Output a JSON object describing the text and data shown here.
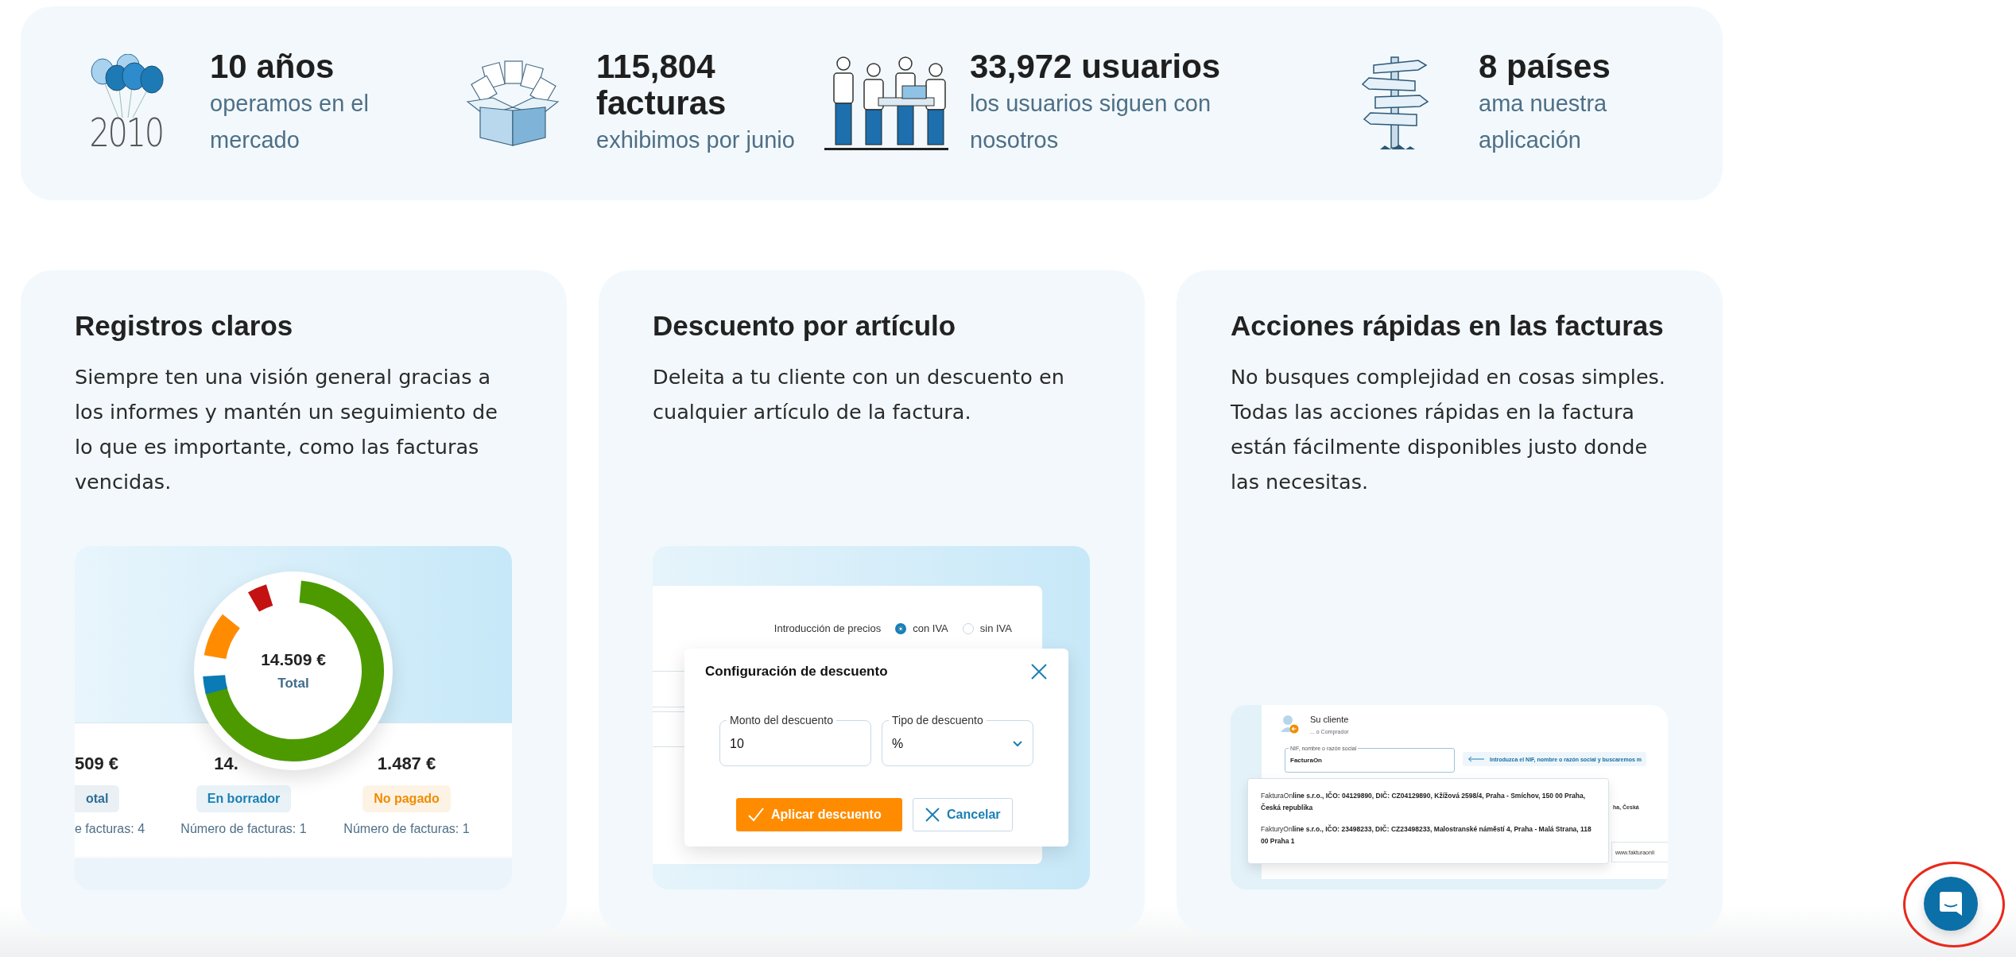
{
  "stats": [
    {
      "kind": "balloons",
      "illustration_text": "2010",
      "value": "10 años",
      "caption": "operamos en el mercado"
    },
    {
      "kind": "box",
      "value": "115,804 facturas",
      "caption": "exhibimos por junio"
    },
    {
      "kind": "team",
      "value": "33,972 usuarios",
      "caption": "los usuarios siguen con nosotros"
    },
    {
      "kind": "signpost",
      "value": "8 países",
      "caption": "ama nuestra aplicación"
    }
  ],
  "features": [
    {
      "kind": "report",
      "title": "Registros claros",
      "text": "Siempre ten una visión general gracias a los informes y mantén un seguimiento de lo que es importante, como las facturas vencidas.",
      "mockup": {
        "total_value": "14.509 €",
        "total_label": "Total",
        "columns": [
          {
            "amount": "509 €",
            "status": "otal",
            "count": "e facturas: 4",
            "color": "#2d6d96"
          },
          {
            "amount": "14.",
            "status": "En borrador",
            "count": "Número de facturas: 1",
            "color": "#1a7fb5"
          },
          {
            "amount": "1.487 €",
            "status": "No pagado",
            "count": "Número de facturas: 1",
            "color": "#f08c00"
          }
        ]
      }
    },
    {
      "kind": "discount",
      "title": "Descuento por artículo",
      "text": "Deleita a tu cliente con un descuento en cualquier artículo de la factura.",
      "mockup": {
        "price_label": "Introducción de precios",
        "price_options": [
          {
            "label": "con IVA",
            "selected": true
          },
          {
            "label": "sin IVA",
            "selected": false
          }
        ],
        "dialog_title": "Configuración de descuento",
        "fields": [
          {
            "kind": "text",
            "label": "Monto del descuento",
            "value": "10"
          },
          {
            "kind": "select",
            "label": "Tipo de descuento",
            "value": "%"
          }
        ],
        "buttons": [
          {
            "kind": "primary",
            "label": "Aplicar descuento"
          },
          {
            "kind": "secondary",
            "label": "Cancelar"
          }
        ]
      }
    },
    {
      "kind": "quick_actions",
      "title": "Acciones rápidas en las facturas",
      "text": "No busques complejidad en cosas simples. Todas las acciones rápidas en la factura están fácilmente disponibles justo donde las necesitas.",
      "mockup": {
        "title": "Su cliente",
        "subtitle": "... o Comprador",
        "field_label": "NIF, nombre o razón social",
        "field_value": "FacturaOn",
        "hint": "Introduzca el NIF, nombre o razón social y buscaremos m",
        "suggestions": [
          "FakturaOn**line s.r.o., IČO: 04129890, DIČ: CZ04129890, Kžížová 2598/4, Praha - Smíchov, 150 00 Praha, Česká republika**",
          "FakturyOn**line s.r.o., IČO: 23498233, DIČ: CZ23498233, Malostranské náměstí 4, Praha - Malá Strana, 118 00 Praha 1**"
        ],
        "behind_texts": [
          "ha, Česká",
          "www.fakturaonli"
        ]
      }
    }
  ],
  "chat_button": {
    "highlighted": true
  }
}
